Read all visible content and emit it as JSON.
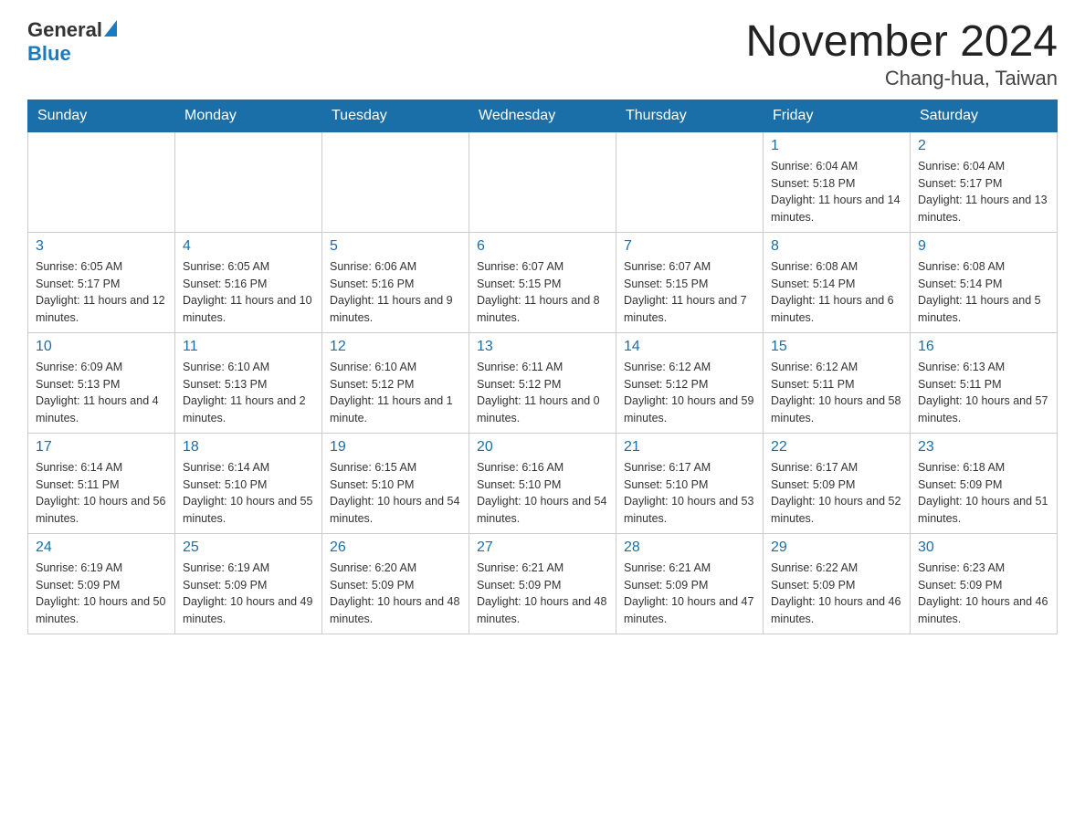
{
  "header": {
    "logo_general": "General",
    "logo_blue": "Blue",
    "title": "November 2024",
    "subtitle": "Chang-hua, Taiwan"
  },
  "calendar": {
    "weekdays": [
      "Sunday",
      "Monday",
      "Tuesday",
      "Wednesday",
      "Thursday",
      "Friday",
      "Saturday"
    ],
    "rows": [
      [
        {
          "day": "",
          "info": ""
        },
        {
          "day": "",
          "info": ""
        },
        {
          "day": "",
          "info": ""
        },
        {
          "day": "",
          "info": ""
        },
        {
          "day": "",
          "info": ""
        },
        {
          "day": "1",
          "info": "Sunrise: 6:04 AM\nSunset: 5:18 PM\nDaylight: 11 hours and 14 minutes."
        },
        {
          "day": "2",
          "info": "Sunrise: 6:04 AM\nSunset: 5:17 PM\nDaylight: 11 hours and 13 minutes."
        }
      ],
      [
        {
          "day": "3",
          "info": "Sunrise: 6:05 AM\nSunset: 5:17 PM\nDaylight: 11 hours and 12 minutes."
        },
        {
          "day": "4",
          "info": "Sunrise: 6:05 AM\nSunset: 5:16 PM\nDaylight: 11 hours and 10 minutes."
        },
        {
          "day": "5",
          "info": "Sunrise: 6:06 AM\nSunset: 5:16 PM\nDaylight: 11 hours and 9 minutes."
        },
        {
          "day": "6",
          "info": "Sunrise: 6:07 AM\nSunset: 5:15 PM\nDaylight: 11 hours and 8 minutes."
        },
        {
          "day": "7",
          "info": "Sunrise: 6:07 AM\nSunset: 5:15 PM\nDaylight: 11 hours and 7 minutes."
        },
        {
          "day": "8",
          "info": "Sunrise: 6:08 AM\nSunset: 5:14 PM\nDaylight: 11 hours and 6 minutes."
        },
        {
          "day": "9",
          "info": "Sunrise: 6:08 AM\nSunset: 5:14 PM\nDaylight: 11 hours and 5 minutes."
        }
      ],
      [
        {
          "day": "10",
          "info": "Sunrise: 6:09 AM\nSunset: 5:13 PM\nDaylight: 11 hours and 4 minutes."
        },
        {
          "day": "11",
          "info": "Sunrise: 6:10 AM\nSunset: 5:13 PM\nDaylight: 11 hours and 2 minutes."
        },
        {
          "day": "12",
          "info": "Sunrise: 6:10 AM\nSunset: 5:12 PM\nDaylight: 11 hours and 1 minute."
        },
        {
          "day": "13",
          "info": "Sunrise: 6:11 AM\nSunset: 5:12 PM\nDaylight: 11 hours and 0 minutes."
        },
        {
          "day": "14",
          "info": "Sunrise: 6:12 AM\nSunset: 5:12 PM\nDaylight: 10 hours and 59 minutes."
        },
        {
          "day": "15",
          "info": "Sunrise: 6:12 AM\nSunset: 5:11 PM\nDaylight: 10 hours and 58 minutes."
        },
        {
          "day": "16",
          "info": "Sunrise: 6:13 AM\nSunset: 5:11 PM\nDaylight: 10 hours and 57 minutes."
        }
      ],
      [
        {
          "day": "17",
          "info": "Sunrise: 6:14 AM\nSunset: 5:11 PM\nDaylight: 10 hours and 56 minutes."
        },
        {
          "day": "18",
          "info": "Sunrise: 6:14 AM\nSunset: 5:10 PM\nDaylight: 10 hours and 55 minutes."
        },
        {
          "day": "19",
          "info": "Sunrise: 6:15 AM\nSunset: 5:10 PM\nDaylight: 10 hours and 54 minutes."
        },
        {
          "day": "20",
          "info": "Sunrise: 6:16 AM\nSunset: 5:10 PM\nDaylight: 10 hours and 54 minutes."
        },
        {
          "day": "21",
          "info": "Sunrise: 6:17 AM\nSunset: 5:10 PM\nDaylight: 10 hours and 53 minutes."
        },
        {
          "day": "22",
          "info": "Sunrise: 6:17 AM\nSunset: 5:09 PM\nDaylight: 10 hours and 52 minutes."
        },
        {
          "day": "23",
          "info": "Sunrise: 6:18 AM\nSunset: 5:09 PM\nDaylight: 10 hours and 51 minutes."
        }
      ],
      [
        {
          "day": "24",
          "info": "Sunrise: 6:19 AM\nSunset: 5:09 PM\nDaylight: 10 hours and 50 minutes."
        },
        {
          "day": "25",
          "info": "Sunrise: 6:19 AM\nSunset: 5:09 PM\nDaylight: 10 hours and 49 minutes."
        },
        {
          "day": "26",
          "info": "Sunrise: 6:20 AM\nSunset: 5:09 PM\nDaylight: 10 hours and 48 minutes."
        },
        {
          "day": "27",
          "info": "Sunrise: 6:21 AM\nSunset: 5:09 PM\nDaylight: 10 hours and 48 minutes."
        },
        {
          "day": "28",
          "info": "Sunrise: 6:21 AM\nSunset: 5:09 PM\nDaylight: 10 hours and 47 minutes."
        },
        {
          "day": "29",
          "info": "Sunrise: 6:22 AM\nSunset: 5:09 PM\nDaylight: 10 hours and 46 minutes."
        },
        {
          "day": "30",
          "info": "Sunrise: 6:23 AM\nSunset: 5:09 PM\nDaylight: 10 hours and 46 minutes."
        }
      ]
    ]
  }
}
